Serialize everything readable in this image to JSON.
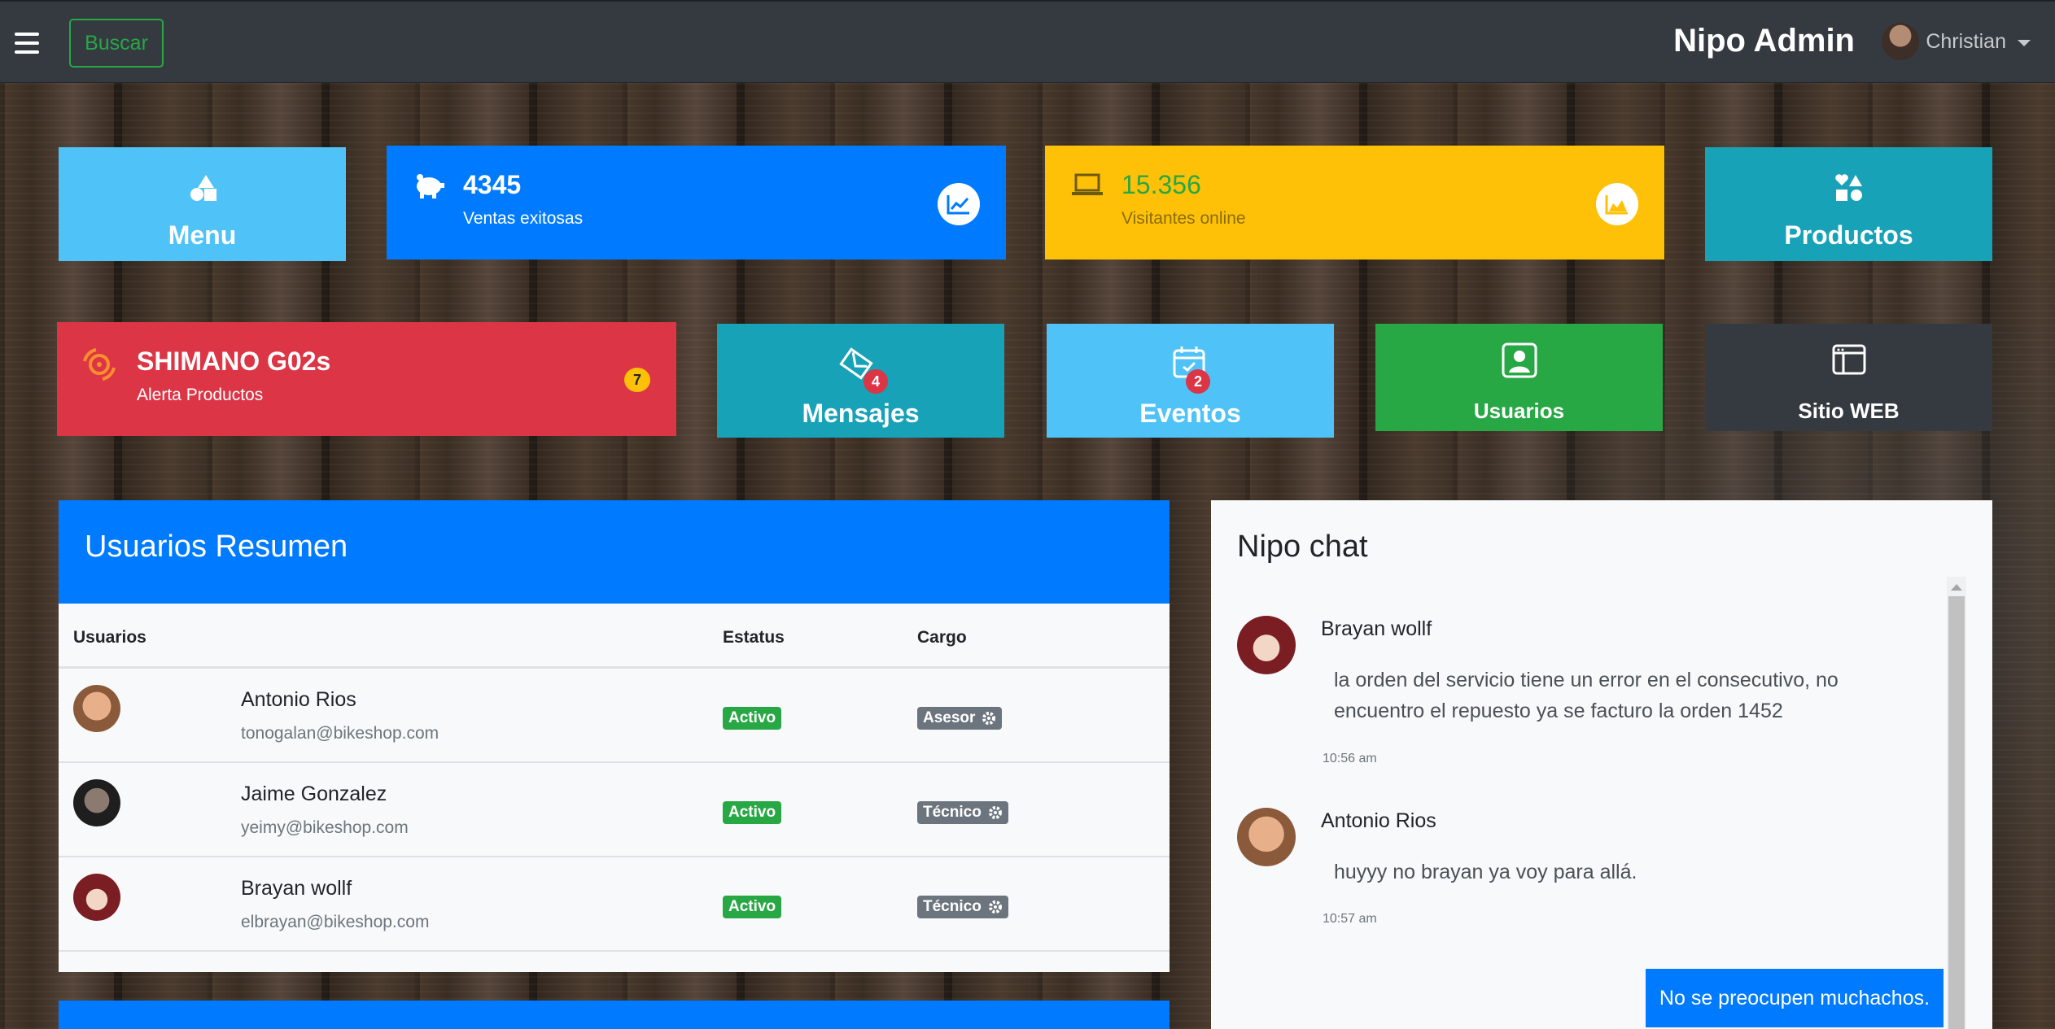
{
  "navbar": {
    "search_label": "Buscar",
    "brand": "Nipo Admin",
    "user_name": "Christian"
  },
  "tiles": {
    "menu": {
      "label": "Menu",
      "color": "#4fc3f7"
    },
    "ventas": {
      "value": "4345",
      "label": "Ventas exitosas",
      "color": "#007bff"
    },
    "visitantes": {
      "value": "15.356",
      "label": "Visitantes online",
      "color": "#ffc107"
    },
    "productos": {
      "label": "Productos",
      "color": "#17a2b8"
    },
    "alerta": {
      "title": "SHIMANO G02s",
      "label": "Alerta Productos",
      "badge": "7",
      "color": "#dc3545"
    },
    "mensajes": {
      "label": "Mensajes",
      "badge": "4",
      "color": "#17a2b8"
    },
    "eventos": {
      "label": "Eventos",
      "badge": "2",
      "color": "#4fc3f7"
    },
    "usuarios": {
      "label": "Usuarios",
      "color": "#28a745"
    },
    "sitio": {
      "label": "Sitio WEB",
      "color": "#343a40"
    }
  },
  "usuarios_card": {
    "title": "Usuarios Resumen",
    "columns": [
      "Usuarios",
      "Estatus",
      "Cargo"
    ],
    "rows": [
      {
        "name": "Antonio Rios",
        "email": "tonogalan@bikeshop.com",
        "status": "Activo",
        "role": "Asesor"
      },
      {
        "name": "Jaime Gonzalez",
        "email": "yeimy@bikeshop.com",
        "status": "Activo",
        "role": "Técnico"
      },
      {
        "name": "Brayan wollf",
        "email": "elbrayan@bikeshop.com",
        "status": "Activo",
        "role": "Técnico"
      }
    ]
  },
  "chat": {
    "title": "Nipo chat",
    "messages": [
      {
        "author": "Brayan wollf",
        "text": "la orden del servicio tiene un error en el consecutivo, no encuentro el repuesto ya se facturo la orden 1452",
        "time": "10:56 am"
      },
      {
        "author": "Antonio Rios",
        "text": "huyyy no brayan ya voy para allá.",
        "time": "10:57 am"
      }
    ],
    "outgoing": "No se preocupen muchachos."
  }
}
